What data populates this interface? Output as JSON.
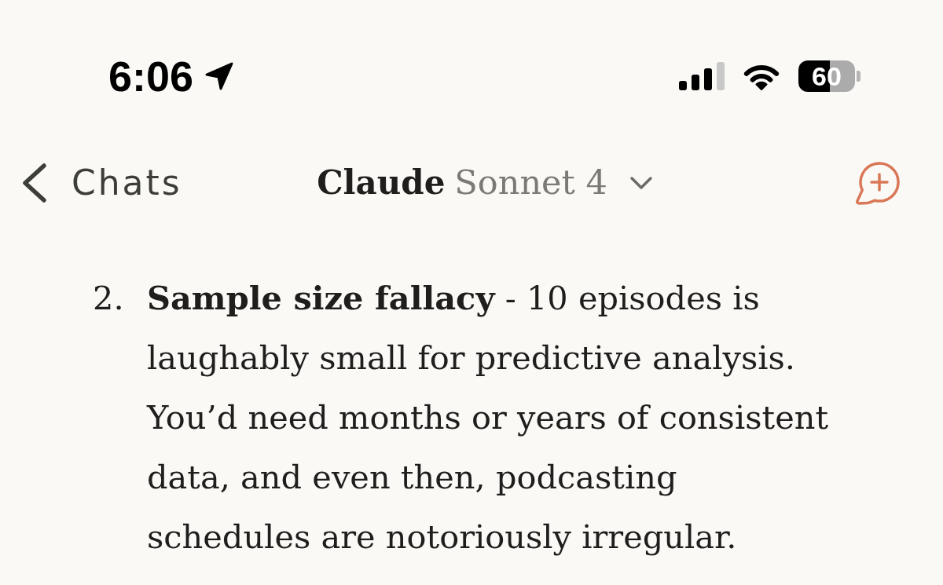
{
  "status_bar": {
    "time": "6:06",
    "battery": "60"
  },
  "nav_bar": {
    "back": "Chats",
    "title": "Claude",
    "model": "Sonnet 4"
  },
  "message": {
    "items": [
      {
        "number": "2.",
        "text": "**Sample size fallacy** - 10 episodes is laughably small for predictive analysis. You’d need months or years of consistent data, and even then, podcasting schedules are notoriously irregular."
      }
    ]
  }
}
